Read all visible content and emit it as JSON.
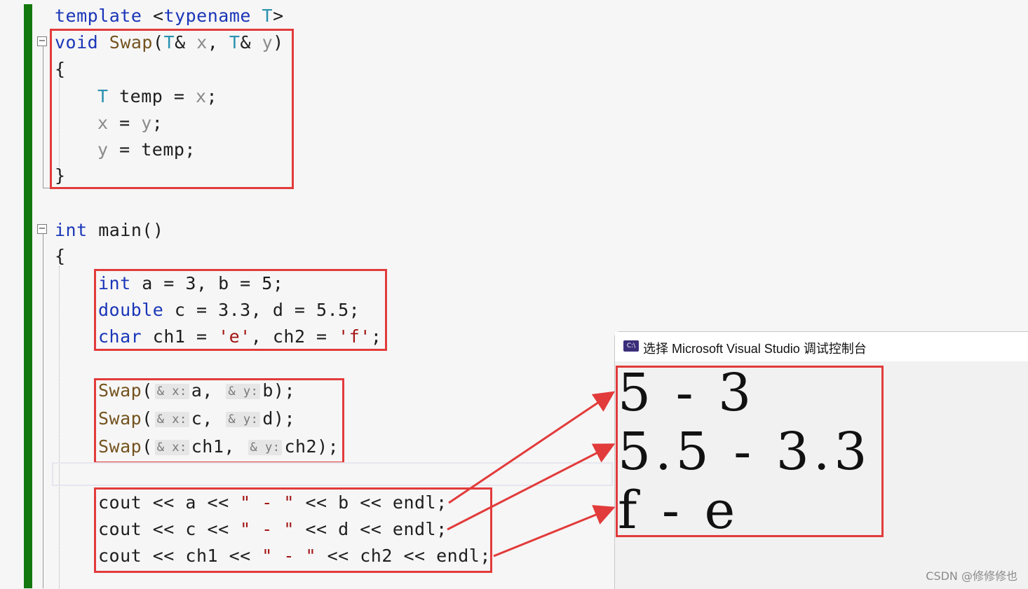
{
  "editor": {
    "template_lines": {
      "l1": {
        "kw1": "template",
        "p1": " <",
        "kw2": "typename",
        "p2": " ",
        "ty": "T",
        "p3": ">"
      },
      "l2": {
        "kw": "void",
        "p1": " ",
        "fn": "Swap",
        "p2": "(",
        "ty1": "T",
        "p3": "& ",
        "v1": "x",
        "p4": ", ",
        "ty2": "T",
        "p5": "& ",
        "v2": "y",
        "p6": ")"
      },
      "l3": "{",
      "l4": {
        "ty": "T",
        "rest": " temp = ",
        "v": "x",
        "end": ";"
      },
      "l5": {
        "v1": "x",
        "mid": " = ",
        "v2": "y",
        "end": ";"
      },
      "l6": {
        "v": "y",
        "rest": " = temp;"
      },
      "l7": "}"
    },
    "main_lines": {
      "sig": {
        "kw": "int",
        "rest": " main()"
      },
      "open": "{",
      "d1": {
        "kw": "int",
        "rest": " a = 3, b = 5;"
      },
      "d2": {
        "kw": "double",
        "rest": " c = 3.3, d = 5.5;"
      },
      "d3": {
        "kw": "char",
        "p1": " ch1 = ",
        "s1": "'e'",
        "p2": ", ch2 = ",
        "s2": "'f'",
        "end": ";"
      },
      "s1": {
        "fn": "Swap",
        "o": "(",
        "h1": "& x:",
        "a1": "a, ",
        "h2": "& y:",
        "a2": "b",
        "c": ");"
      },
      "s2": {
        "fn": "Swap",
        "o": "(",
        "h1": "& x:",
        "a1": "c, ",
        "h2": "& y:",
        "a2": "d",
        "c": ");"
      },
      "s3": {
        "fn": "Swap",
        "o": "(",
        "h1": "& x:",
        "a1": "ch1, ",
        "h2": "& y:",
        "a2": "ch2",
        "c": ");"
      },
      "c1": {
        "p1": "cout << a << ",
        "s": "\" - \"",
        "p2": " << b << endl;"
      },
      "c2": {
        "p1": "cout << c << ",
        "s": "\" - \"",
        "p2": " << d << endl;"
      },
      "c3": {
        "p1": "cout << ch1 << ",
        "s": "\" - \"",
        "p2": " << ch2 << endl;"
      }
    },
    "fold_collapse_symbol": "−"
  },
  "console": {
    "icon_text": "C:\\",
    "title": "选择 Microsoft Visual Studio 调试控制台",
    "output": [
      "5 - 3",
      "5.5 - 3.3",
      "f - e"
    ]
  },
  "watermark": "CSDN @修修修也",
  "colors": {
    "annotation_red": "#e23b3b",
    "keyword": "#1a36b8",
    "type": "#2b91af",
    "string": "#a31515",
    "change_bar": "#13780e"
  }
}
